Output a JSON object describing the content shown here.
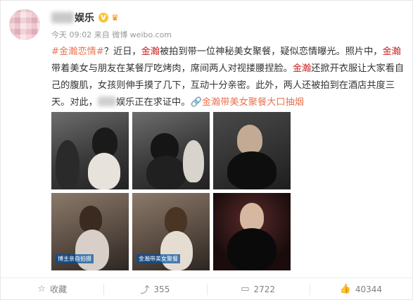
{
  "header": {
    "name": "娱乐",
    "verified_glyph": "V",
    "vip_glyph": "♛",
    "meta": "今天 09:02 来自 微博 weibo.com"
  },
  "post": {
    "topic": "#金瀚恋情#",
    "t1": "？近日，",
    "hl1": "金瀚",
    "t2": "被拍到带一位神秘美女聚餐，疑似恋情曝光。照片中，",
    "hl2": "金瀚",
    "t3": "带着美女与朋友在某餐厅吃烤肉，席间两人对视搂腰捏脸。",
    "hl3": "金瀚",
    "t4": "还掀开衣服让大家看自己的腹肌，女孩则伸手摸了几下，互动十分亲密。此外，两人还被拍到在酒店共度三天。对此，",
    "t5": "娱乐正在求证中。",
    "link_icon": "🔗",
    "link": "金瀚带美女聚餐大口抽烟"
  },
  "photos": [
    {
      "tone": "dim"
    },
    {
      "tone": "dim"
    },
    {
      "tone": "dark"
    },
    {
      "tone": "warm",
      "caption": "博主亲自拍摄"
    },
    {
      "tone": "warm",
      "caption": "金瀚带美女聚餐"
    },
    {
      "tone": "stage"
    }
  ],
  "footer": {
    "favorite_icon": "☆",
    "favorite_label": "收藏",
    "repost_icon": "⤴",
    "repost_count": "355",
    "comment_icon": "▭",
    "comment_count": "2722",
    "like_icon": "👍",
    "like_count": "40344"
  }
}
